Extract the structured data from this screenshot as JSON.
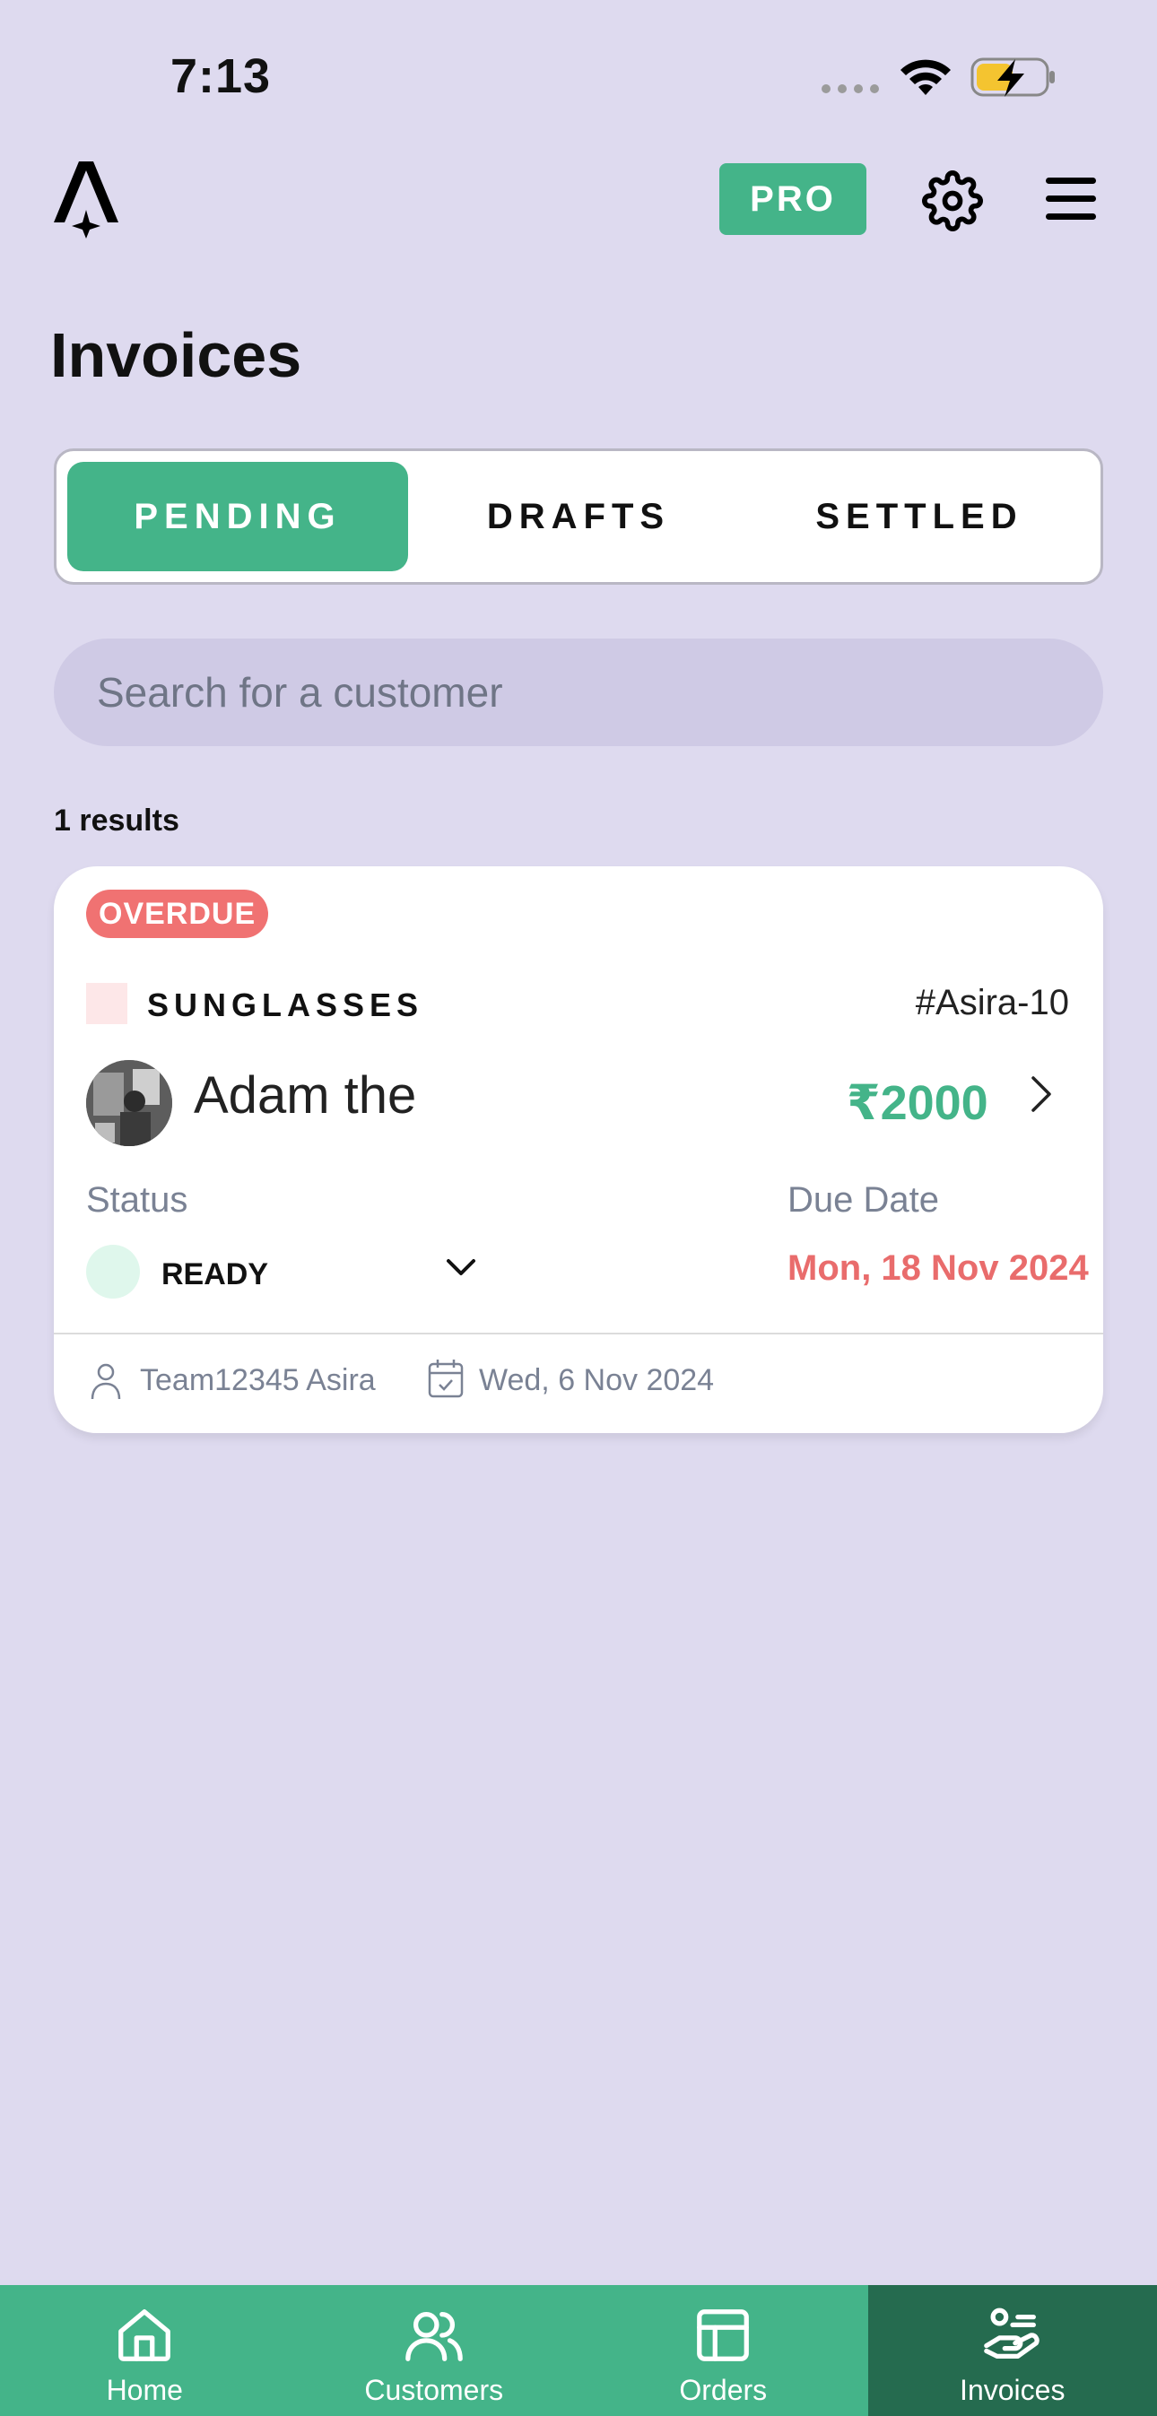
{
  "status_bar": {
    "time": "7:13"
  },
  "header": {
    "pro_label": "PRO"
  },
  "page": {
    "title": "Invoices"
  },
  "tabs": [
    {
      "label": "PENDING",
      "active": true
    },
    {
      "label": "DRAFTS",
      "active": false
    },
    {
      "label": "SETTLED",
      "active": false
    }
  ],
  "search": {
    "placeholder": "Search for a customer"
  },
  "results": {
    "count_text": "1 results"
  },
  "invoice_card": {
    "badge": "OVERDUE",
    "category": "SUNGLASSES",
    "invoice_id": "#Asira-10",
    "customer_name": "Adam the",
    "amount": "₹2000",
    "status_label": "Status",
    "status_value": "READY",
    "due_label": "Due Date",
    "due_value": "Mon, 18 Nov 2024",
    "team": "Team12345 Asira",
    "created_date": "Wed, 6 Nov 2024"
  },
  "bottom_nav": [
    {
      "label": "Home",
      "icon": "home-icon"
    },
    {
      "label": "Customers",
      "icon": "customers-icon"
    },
    {
      "label": "Orders",
      "icon": "orders-icon"
    },
    {
      "label": "Invoices",
      "icon": "invoices-icon",
      "active": true
    }
  ],
  "colors": {
    "background": "#DEDAEF",
    "accent": "#44B489",
    "accent_dark": "#256B4F",
    "overdue": "#F07272"
  }
}
